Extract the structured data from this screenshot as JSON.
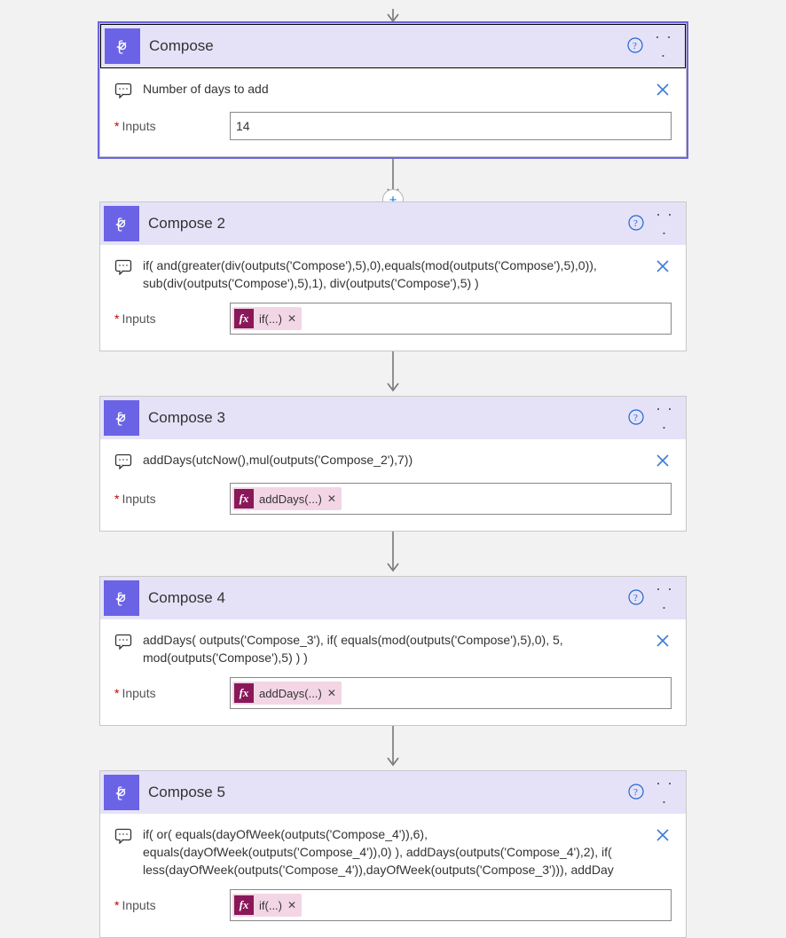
{
  "labels": {
    "inputs": "Inputs"
  },
  "actions": [
    {
      "title": "Compose",
      "selected": true,
      "showPlusAfter": true,
      "comment": "Number of days to add",
      "inputType": "text",
      "inputValue": "14"
    },
    {
      "title": "Compose 2",
      "selected": false,
      "showPlusAfter": false,
      "comment": "if( and(greater(div(outputs('Compose'),5),0),equals(mod(outputs('Compose'),5),0)), sub(div(outputs('Compose'),5),1), div(outputs('Compose'),5) )",
      "inputType": "pill",
      "pillLabel": "if(...)"
    },
    {
      "title": "Compose 3",
      "selected": false,
      "showPlusAfter": false,
      "comment": "addDays(utcNow(),mul(outputs('Compose_2'),7))",
      "inputType": "pill",
      "pillLabel": "addDays(...)"
    },
    {
      "title": "Compose 4",
      "selected": false,
      "showPlusAfter": false,
      "comment": "addDays( outputs('Compose_3'), if( equals(mod(outputs('Compose'),5),0), 5, mod(outputs('Compose'),5) ) )",
      "inputType": "pill",
      "pillLabel": "addDays(...)"
    },
    {
      "title": "Compose 5",
      "selected": false,
      "showPlusAfter": false,
      "comment": "if( or( equals(dayOfWeek(outputs('Compose_4')),6), equals(dayOfWeek(outputs('Compose_4')),0) ), addDays(outputs('Compose_4'),2), if( less(dayOfWeek(outputs('Compose_4')),dayOfWeek(outputs('Compose_3'))), addDay",
      "inputType": "pill",
      "pillLabel": "if(...)"
    }
  ]
}
